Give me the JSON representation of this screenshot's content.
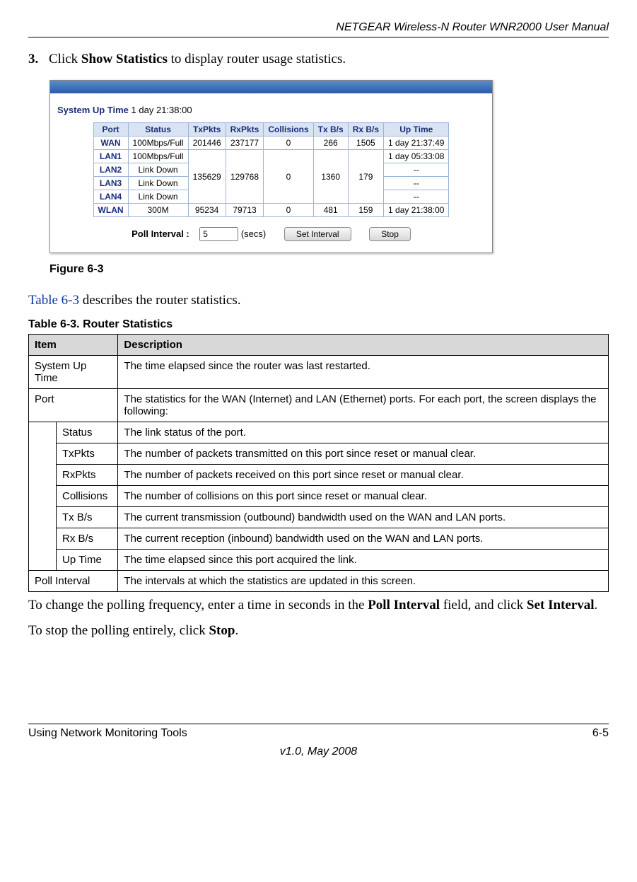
{
  "header": {
    "title": "NETGEAR Wireless-N Router WNR2000 User Manual"
  },
  "step": {
    "num": "3.",
    "pre": "Click ",
    "bold": "Show Statistics",
    "post": " to display router usage statistics."
  },
  "shot": {
    "sysup_label": "System Up Time",
    "sysup_value": "1 day 21:38:00",
    "headers": [
      "Port",
      "Status",
      "TxPkts",
      "RxPkts",
      "Collisions",
      "Tx B/s",
      "Rx B/s",
      "Up Time"
    ],
    "rows": [
      {
        "port": "WAN",
        "status": "100Mbps/Full",
        "tx": "201446",
        "rx": "237177",
        "col": "0",
        "txb": "266",
        "rxb": "1505",
        "up": "1 day 21:37:49"
      },
      {
        "port": "LAN1",
        "status": "100Mbps/Full",
        "tx": "",
        "rx": "",
        "col": "",
        "txb": "",
        "rxb": "",
        "up": "1 day 05:33:08"
      },
      {
        "port": "LAN2",
        "status": "Link Down",
        "tx": "135629",
        "rx": "129768",
        "col": "0",
        "txb": "1360",
        "rxb": "179",
        "up": "--"
      },
      {
        "port": "LAN3",
        "status": "Link Down",
        "tx": "",
        "rx": "",
        "col": "",
        "txb": "",
        "rxb": "",
        "up": "--"
      },
      {
        "port": "LAN4",
        "status": "Link Down",
        "tx": "",
        "rx": "",
        "col": "",
        "txb": "",
        "rxb": "",
        "up": "--"
      },
      {
        "port": "WLAN",
        "status": "300M",
        "tx": "95234",
        "rx": "79713",
        "col": "0",
        "txb": "481",
        "rxb": "159",
        "up": "1 day 21:38:00"
      }
    ],
    "poll_label": "Poll Interval :",
    "poll_value": "5",
    "poll_unit": "(secs)",
    "set_btn": "Set Interval",
    "stop_btn": "Stop"
  },
  "fig_caption": "Figure 6-3",
  "ref_line": {
    "link": "Table 6-3",
    "post": " describes the router statistics."
  },
  "def_title": "Table 6-3. Router Statistics",
  "def_headers": {
    "item": "Item",
    "desc": "Description"
  },
  "def_rows": [
    {
      "item": "System Up Time",
      "desc": "The time elapsed since the router was last restarted.",
      "sub": false
    },
    {
      "item": "Port",
      "desc": "The statistics for the WAN (Internet) and LAN (Ethernet) ports. For each port, the screen displays the following:",
      "sub": false
    },
    {
      "item": "Status",
      "desc": "The link status of the port.",
      "sub": true
    },
    {
      "item": "TxPkts",
      "desc": "The number of packets transmitted on this port since reset or manual clear.",
      "sub": true
    },
    {
      "item": "RxPkts",
      "desc": "The number of packets received on this port since reset or manual clear.",
      "sub": true
    },
    {
      "item": "Collisions",
      "desc": "The number of collisions on this port since reset or manual clear.",
      "sub": true
    },
    {
      "item": "Tx B/s",
      "desc": "The current transmission (outbound) bandwidth used on the WAN and LAN ports.",
      "sub": true
    },
    {
      "item": "Rx B/s",
      "desc": "The current reception (inbound) bandwidth used on the WAN and LAN ports.",
      "sub": true
    },
    {
      "item": "Up Time",
      "desc": "The time elapsed since this port acquired the link.",
      "sub": true
    },
    {
      "item": "Poll Interval",
      "desc": "The intervals at which the statistics are updated in this screen.",
      "sub": false
    }
  ],
  "para1": {
    "pre": "To change the polling frequency, enter a time in seconds in the ",
    "b1": "Poll Interval",
    "mid": " field, and click ",
    "b2": "Set Interval",
    "post": "."
  },
  "para2": {
    "pre": "To stop the polling entirely, click ",
    "b": "Stop",
    "post": "."
  },
  "footer": {
    "left": "Using Network Monitoring Tools",
    "right": "6-5",
    "ver": "v1.0, May 2008"
  }
}
